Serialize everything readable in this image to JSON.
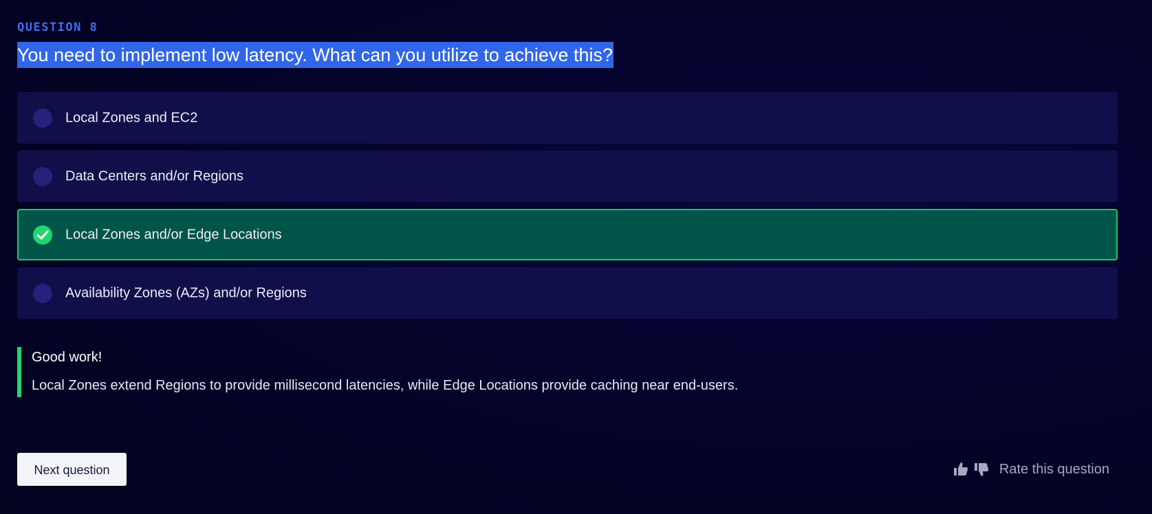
{
  "question": {
    "label": "QUESTION 8",
    "text": "You need to implement low latency. What can you utilize to achieve this?"
  },
  "options": [
    {
      "label": "Local Zones and EC2",
      "state": "unselected"
    },
    {
      "label": "Data Centers and/or Regions",
      "state": "unselected"
    },
    {
      "label": "Local Zones and/or Edge Locations",
      "state": "correct"
    },
    {
      "label": "Availability Zones (AZs) and/or Regions",
      "state": "unselected"
    }
  ],
  "feedback": {
    "title": "Good work!",
    "text": "Local Zones extend Regions to provide millisecond latencies, while Edge Locations provide caching near end-users."
  },
  "actions": {
    "next_label": "Next question",
    "rate_label": "Rate this question",
    "thumbs_up_icon": "thumbs-up-icon",
    "thumbs_down_icon": "thumbs-down-icon"
  },
  "colors": {
    "background": "#040326",
    "accent_blue": "#3266e8",
    "option_bg": "#110f4a",
    "correct_bg": "#005548",
    "correct_border": "#1ec66a",
    "success_green": "#1fd76b"
  }
}
